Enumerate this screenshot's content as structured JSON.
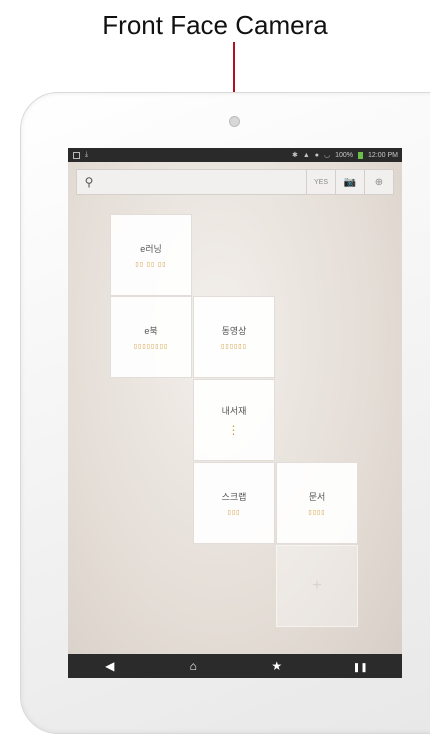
{
  "caption": "Front Face Camera",
  "status_bar": {
    "battery": "100%",
    "time": "12:00 PM"
  },
  "search": {
    "placeholder": "",
    "buttons": [
      {
        "icon": "voice-search-icon",
        "label": "YES"
      },
      {
        "icon": "camera-icon",
        "label": "📷"
      },
      {
        "icon": "globe-icon",
        "label": "⊕"
      }
    ]
  },
  "tiles": [
    {
      "title": "e러닝",
      "subtitle": "▯▯ ▯▯ ▯▯"
    },
    {
      "title": "e북",
      "subtitle": "▯▯▯▯▯▯▯▯"
    },
    {
      "title": "동영상",
      "subtitle": "▯▯▯▯▯▯"
    },
    {
      "title": "내서재",
      "subtitle": "⋮"
    },
    {
      "title": "스크랩",
      "subtitle": "▯▯▯"
    },
    {
      "title": "문서",
      "subtitle": "▯▯▯▯"
    }
  ],
  "add_tile": {
    "label": "+"
  },
  "nav": {
    "back": "◀",
    "home": "⌂",
    "favorite": "★",
    "menu": "❚❚"
  },
  "colors": {
    "pointer": "#c41228",
    "accent_text": "#d39a3a",
    "bar": "#2b2b2b"
  }
}
